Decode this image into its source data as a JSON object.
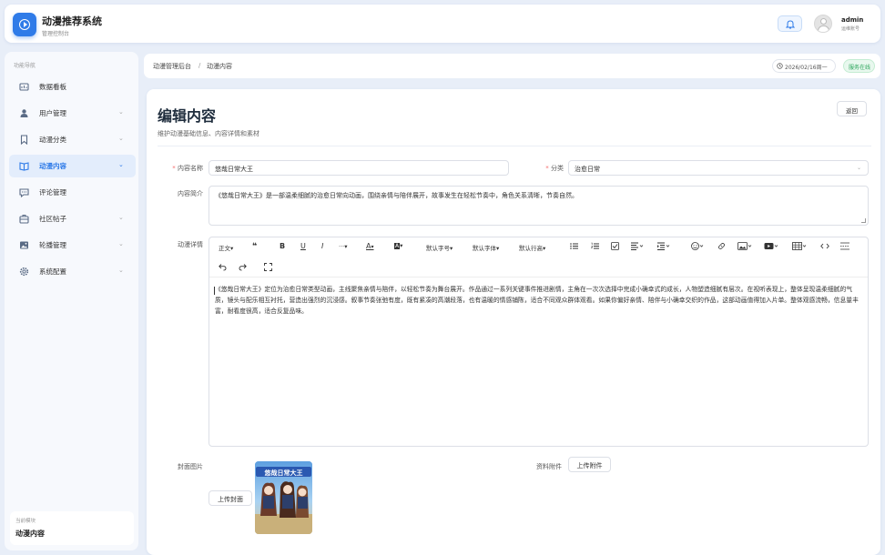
{
  "app": {
    "title": "动漫推荐系统",
    "subtitle": "管理控制台"
  },
  "header": {
    "bell_icon": "bell-icon",
    "user_name": "admin",
    "user_role": "运维账号"
  },
  "sidebar": {
    "caption": "功能导航",
    "items": [
      {
        "label": "数据看板",
        "icon": "dashboard-icon",
        "has_children": false
      },
      {
        "label": "用户管理",
        "icon": "user-icon",
        "has_children": true
      },
      {
        "label": "动漫分类",
        "icon": "bookmark-icon",
        "has_children": true
      },
      {
        "label": "动漫内容",
        "icon": "book-icon",
        "has_children": true,
        "active": true
      },
      {
        "label": "评论管理",
        "icon": "comment-icon",
        "has_children": false
      },
      {
        "label": "社区帖子",
        "icon": "briefcase-icon",
        "has_children": true
      },
      {
        "label": "轮播管理",
        "icon": "image-icon",
        "has_children": true
      },
      {
        "label": "系统配置",
        "icon": "gear-icon",
        "has_children": true
      }
    ],
    "chevron": "⌄",
    "current_caption": "当前模块",
    "current_value": "动漫内容"
  },
  "breadcrumb": {
    "root": "动漫管理后台",
    "sep": "/",
    "current": "动漫内容"
  },
  "status": {
    "date": "2026/02/16周一",
    "service": "服务在线",
    "service_color": "#2aa55a"
  },
  "page": {
    "title": "编辑内容",
    "subtitle": "维护动漫基础信息、内容详情和素材",
    "back_label": "返回"
  },
  "form": {
    "name_label": "内容名称",
    "name_value": "悠哉日常大王",
    "category_label": "分类",
    "category_value": "治愈日常",
    "intro_label": "内容简介",
    "intro_value": "《悠哉日常大王》是一部温柔细腻的治愈日常向动画，围绕亲情与陪伴展开，故事发生在轻松节奏中，角色关系清晰，节奏自然。",
    "detail_label": "动漫详情",
    "cover_label": "封面图片",
    "upload_cover": "上传封面",
    "attach_label": "资料附件",
    "upload_attach": "上传附件",
    "cover_image_title": "悠哉日常大王"
  },
  "toolbar": {
    "paragraph": "正文",
    "quote": "❝",
    "bold": "B",
    "underline": "U",
    "italic": "I",
    "more": "···",
    "font_color": "A",
    "bg_color": "A",
    "font_size": "默认字号",
    "font_family": "默认字体",
    "line_height": "默认行高",
    "dropdown_caret": "▾"
  },
  "editor": {
    "content": "《悠哉日常大王》定位为治愈日常类型动画，主线聚焦亲情与陪伴，以轻松节奏为舞台展开。作品通过一系列关键事件推进剧情，主角在一次次选择中完成小确幸式的成长，人物塑造细腻有层次。在视听表现上，整体呈现温柔细腻的气质，镜头与配乐相互衬托，营造出强烈的沉浸感。叙事节奏张弛有度，既有紧凑的高潮段落，也有温暖的情感铺陈，适合不同观众群体观看。如果你偏好亲情、陪伴与小确幸交织的作品，这部动画值得加入片单。整体观感流畅，信息量丰富，耐看度很高，适合反复品味。"
  },
  "colors": {
    "primary": "#2f7be8",
    "background": "#e8eef8",
    "danger": "#f56c6c"
  }
}
